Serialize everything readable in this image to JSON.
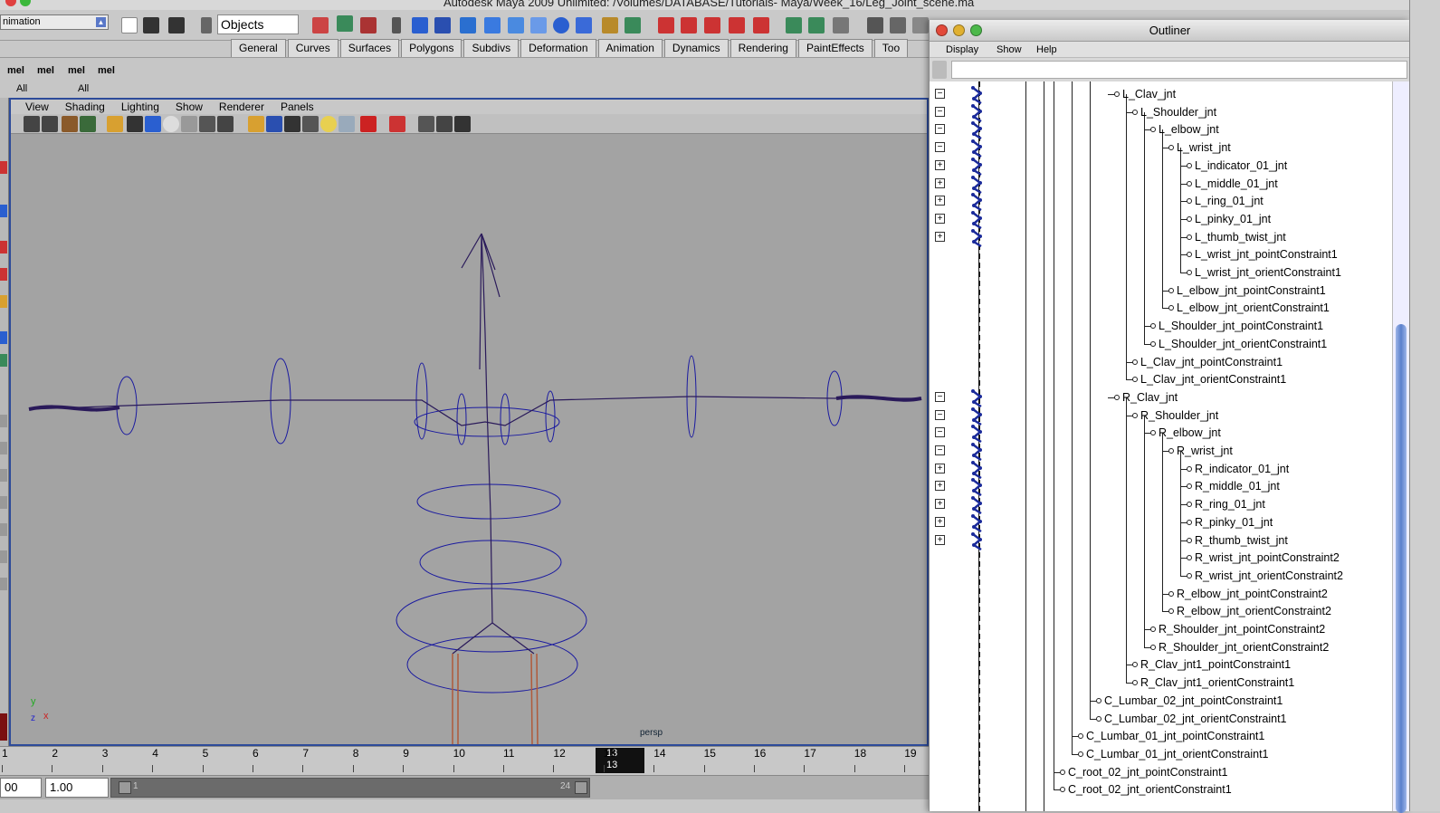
{
  "app": {
    "title": "Autodesk Maya 2009 Unlimited: /Volumes/DATABASE/Tutorials- Maya/Week_16/Leg_Joint_scene.ma"
  },
  "statusline": {
    "mode": "nimation",
    "objects_field": "Objects"
  },
  "shelf_tabs": [
    "General",
    "Curves",
    "Surfaces",
    "Polygons",
    "Subdivs",
    "Deformation",
    "Animation",
    "Dynamics",
    "Rendering",
    "PaintEffects",
    "Too"
  ],
  "shelf": {
    "mel_label": "mel",
    "all_label": "All"
  },
  "panel": {
    "menu": [
      "View",
      "Shading",
      "Lighting",
      "Show",
      "Renderer",
      "Panels"
    ],
    "camera_label": "persp",
    "axis_y": "y",
    "axis_x": "x",
    "axis_z": "z"
  },
  "timeslider": {
    "ticks": [
      "1",
      "2",
      "3",
      "4",
      "5",
      "6",
      "7",
      "8",
      "9",
      "10",
      "11",
      "12",
      "13",
      "14",
      "15",
      "16",
      "17",
      "18",
      "19"
    ],
    "current_frame": "13"
  },
  "range": {
    "start_field": "00",
    "playback_start": "1.00",
    "range_start": "1",
    "range_end": "24"
  },
  "outliner": {
    "title": "Outliner",
    "menu": [
      "Display",
      "Show",
      "Help"
    ],
    "items": [
      {
        "label": "L_Clav_jnt"
      },
      {
        "label": "L_Shoulder_jnt"
      },
      {
        "label": "L_elbow_jnt"
      },
      {
        "label": "L_wrist_jnt"
      },
      {
        "label": "L_indicator_01_jnt"
      },
      {
        "label": "L_middle_01_jnt"
      },
      {
        "label": "L_ring_01_jnt"
      },
      {
        "label": "L_pinky_01_jnt"
      },
      {
        "label": "L_thumb_twist_jnt"
      },
      {
        "label": "L_wrist_jnt_pointConstraint1"
      },
      {
        "label": "L_wrist_jnt_orientConstraint1"
      },
      {
        "label": "L_elbow_jnt_pointConstraint1"
      },
      {
        "label": "L_elbow_jnt_orientConstraint1"
      },
      {
        "label": "L_Shoulder_jnt_pointConstraint1"
      },
      {
        "label": "L_Shoulder_jnt_orientConstraint1"
      },
      {
        "label": "L_Clav_jnt_pointConstraint1"
      },
      {
        "label": "L_Clav_jnt_orientConstraint1"
      },
      {
        "label": "R_Clav_jnt"
      },
      {
        "label": "R_Shoulder_jnt"
      },
      {
        "label": "R_elbow_jnt"
      },
      {
        "label": "R_wrist_jnt"
      },
      {
        "label": "R_indicator_01_jnt"
      },
      {
        "label": "R_middle_01_jnt"
      },
      {
        "label": "R_ring_01_jnt"
      },
      {
        "label": "R_pinky_01_jnt"
      },
      {
        "label": "R_thumb_twist_jnt"
      },
      {
        "label": "R_wrist_jnt_pointConstraint2"
      },
      {
        "label": "R_wrist_jnt_orientConstraint2"
      },
      {
        "label": "R_elbow_jnt_pointConstraint2"
      },
      {
        "label": "R_elbow_jnt_orientConstraint2"
      },
      {
        "label": "R_Shoulder_jnt_pointConstraint2"
      },
      {
        "label": "R_Shoulder_jnt_orientConstraint2"
      },
      {
        "label": "R_Clav_jnt1_pointConstraint1"
      },
      {
        "label": "R_Clav_jnt1_orientConstraint1"
      },
      {
        "label": "C_Lumbar_02_jnt_pointConstraint1"
      },
      {
        "label": "C_Lumbar_02_jnt_orientConstraint1"
      },
      {
        "label": "C_Lumbar_01_jnt_pointConstraint1"
      },
      {
        "label": "C_Lumbar_01_jnt_orientConstraint1"
      },
      {
        "label": "C_root_02_jnt_pointConstraint1"
      },
      {
        "label": "C_root_02_jnt_orientConstraint1"
      }
    ]
  },
  "colors": {
    "panel_border": "#2d4b9a",
    "viewport_bg": "#a3a3a3",
    "skeleton": "#2a1a5a",
    "control_curve": "#1a1aa0",
    "legs": "#b05a3a",
    "scroll_thumb": "#5b80cc"
  }
}
